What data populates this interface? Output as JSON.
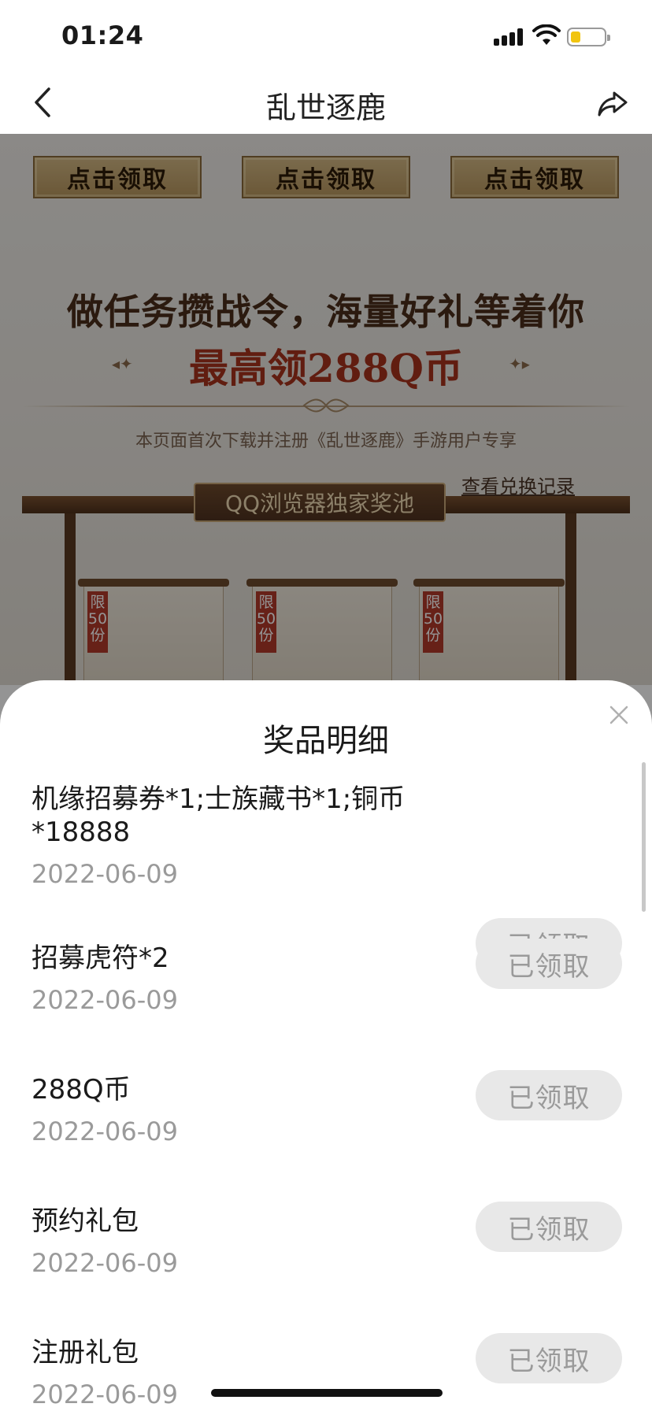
{
  "status_bar": {
    "time": "01:24"
  },
  "nav": {
    "title": "乱世逐鹿"
  },
  "banner": {
    "claim_buttons": [
      "点击领取",
      "点击领取",
      "点击领取"
    ],
    "headline": "做任务攒战令，海量好礼等着你",
    "subheadline": "最高领288Q币",
    "note": "本页面首次下载并注册《乱世逐鹿》手游用户专享",
    "pool_tag": "QQ浏览器独家奖池",
    "record_link": "查看兑换记录",
    "prize_limit_label": "限50份"
  },
  "sheet": {
    "title": "奖品明细",
    "claimed_label": "已领取",
    "items": [
      {
        "name": "机缘招募券*1;士族藏书*1;铜币*18888",
        "date": "2022-06-09"
      },
      {
        "name": "招募虎符*2",
        "date": "2022-06-09"
      },
      {
        "name": "288Q币",
        "date": "2022-06-09"
      },
      {
        "name": "预约礼包",
        "date": "2022-06-09"
      },
      {
        "name": "注册礼包",
        "date": "2022-06-09"
      }
    ]
  },
  "colors": {
    "claimed_button_bg": "#e8e8e8",
    "claimed_button_text": "#9a9a9a",
    "date_text": "#9a9a9a",
    "headline_text": "#4a2e1a",
    "subheadline_text": "#a8321c"
  },
  "icons": [
    "back-icon",
    "share-icon",
    "close-icon",
    "signal-icon",
    "wifi-icon",
    "battery-icon"
  ]
}
